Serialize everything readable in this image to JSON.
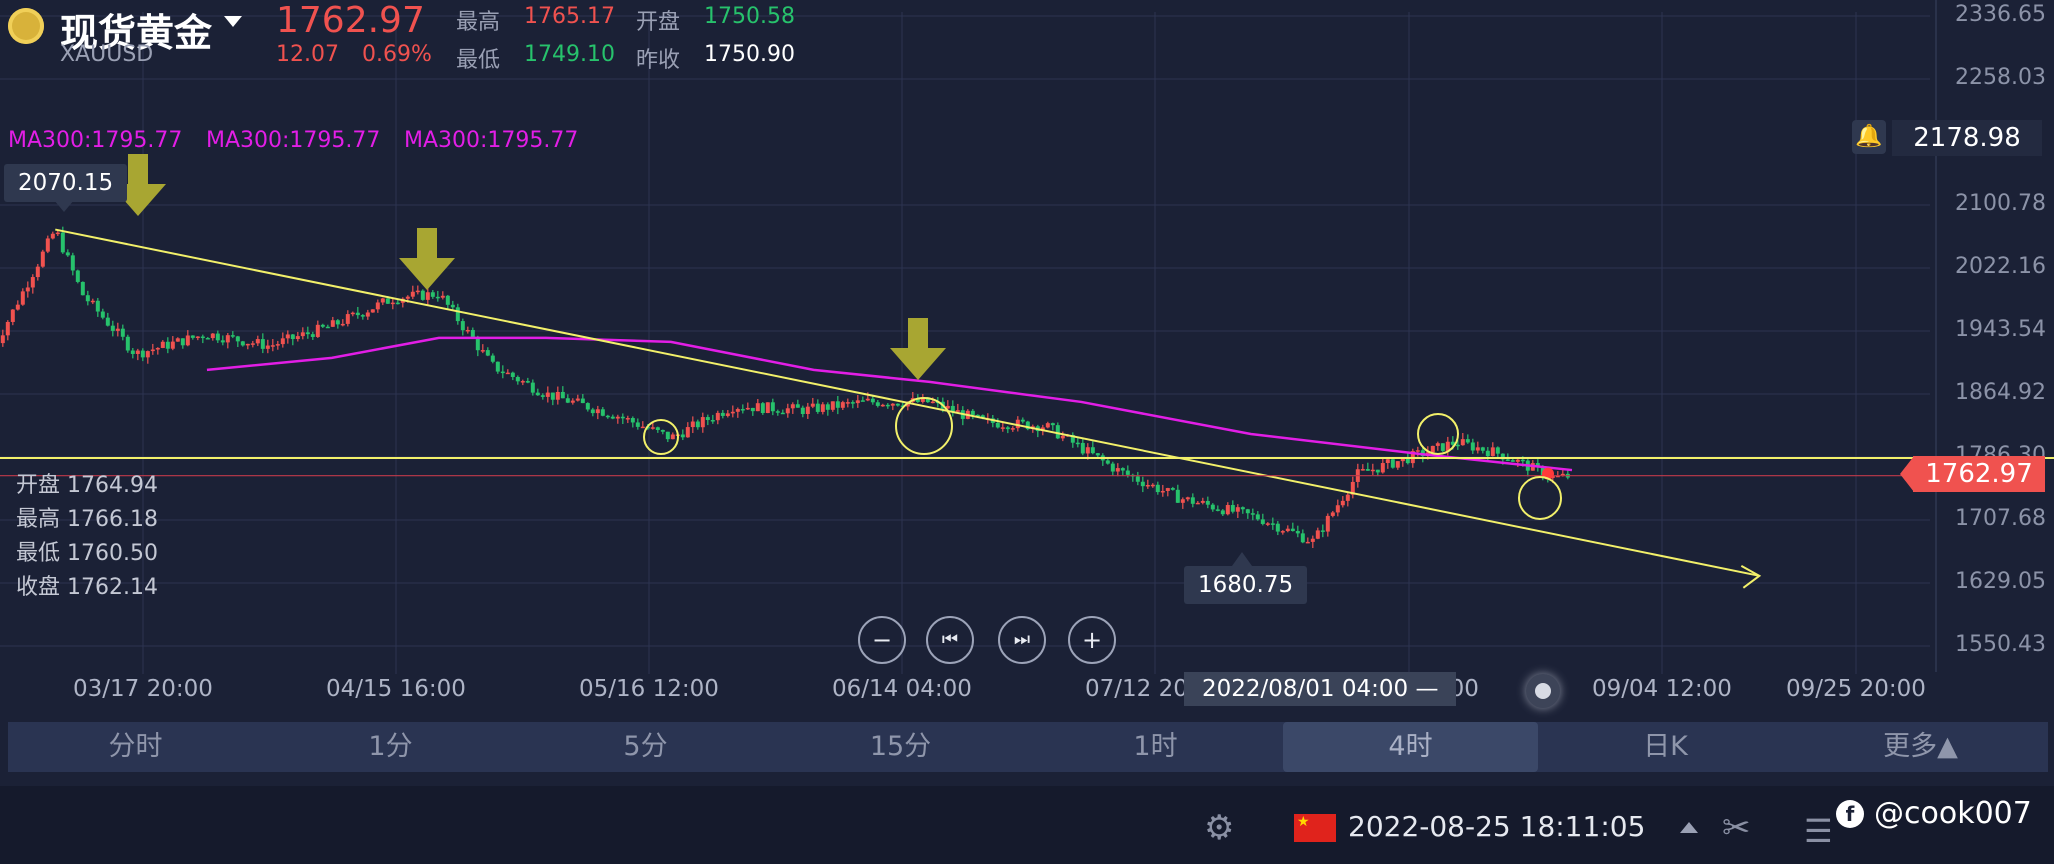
{
  "header": {
    "title": "现货黄金",
    "symbol": "XAUUSD",
    "last_price": "1762.97",
    "change": "12.07",
    "change_pct": "0.69%",
    "high_label": "最高",
    "high": "1765.17",
    "open_label": "开盘",
    "open": "1750.58",
    "low_label": "最低",
    "low": "1749.10",
    "prev_close_label": "昨收",
    "prev_close": "1750.90"
  },
  "ma_labels": [
    "MA300:1795.77",
    "MA300:1795.77",
    "MA300:1795.77"
  ],
  "alert_price": "2178.98",
  "current_price_tag": "1762.97",
  "high_marker": "2070.15",
  "low_marker": "1680.75",
  "crosshair_time": "2022/08/01 04:00 —",
  "ohlc_panel": {
    "open_label": "开盘",
    "open": "1764.94",
    "high_label": "最高",
    "high": "1766.18",
    "low_label": "最低",
    "low": "1760.50",
    "close_label": "收盘",
    "close": "1762.14"
  },
  "timeframes": [
    "分时",
    "1分",
    "5分",
    "15分",
    "1时",
    "4时",
    "日K",
    "更多▲"
  ],
  "active_timeframe": "4时",
  "status_bar": {
    "datetime": "2022-08-25 18:11:05",
    "watermark": "@cook007"
  },
  "colors": {
    "background": "#1b2136",
    "up": "#f0524f",
    "down": "#27c26c",
    "ma300": "#e21ee6",
    "trendline": "#f2f06a",
    "marker_arrow": "#a8a632"
  },
  "chart_data": {
    "type": "line",
    "title": "现货黄金 XAUUSD 4时",
    "y_ticks": [
      "2336.65",
      "2258.03",
      "2100.78",
      "2022.16",
      "1943.54",
      "1864.92",
      "1786.30",
      "1707.68",
      "1629.05",
      "1550.43"
    ],
    "ylim": [
      1550.43,
      2336.65
    ],
    "x_ticks": [
      "03/17 20:00",
      "04/15 16:00",
      "05/16 12:00",
      "06/14 04:00",
      "07/12 20:00",
      "08/11 20:00",
      "09/04 12:00",
      "09/25 20:00"
    ],
    "series": [
      {
        "name": "price",
        "x": [
          "03/01",
          "03/08",
          "03/11",
          "03/17",
          "03/25",
          "04/01",
          "04/08",
          "04/15",
          "04/20",
          "04/26",
          "05/02",
          "05/10",
          "05/16",
          "05/23",
          "05/31",
          "06/07",
          "06/14",
          "06/20",
          "06/27",
          "07/05",
          "07/12",
          "07/21",
          "07/27",
          "08/01",
          "08/08",
          "08/12",
          "08/17",
          "08/23",
          "08/25"
        ],
        "y": [
          1920,
          2070.15,
          1990,
          1915,
          1940,
          1925,
          1950,
          1985,
          1990,
          1900,
          1865,
          1838,
          1810,
          1850,
          1845,
          1855,
          1855,
          1830,
          1825,
          1770,
          1735,
          1710,
          1680.75,
          1765,
          1790,
          1805,
          1790,
          1760,
          1762.97
        ]
      },
      {
        "name": "MA300",
        "x": [
          "03/25",
          "04/08",
          "04/20",
          "05/02",
          "05/16",
          "06/01",
          "06/14",
          "07/01",
          "07/20",
          "08/08",
          "08/25"
        ],
        "y": [
          1895,
          1910,
          1935,
          1935,
          1930,
          1895,
          1880,
          1855,
          1815,
          1790,
          1770
        ]
      }
    ],
    "annotations": {
      "descending_trendline": {
        "from": [
          "03/08",
          2070.15
        ],
        "to": [
          "09/15",
          1638
        ]
      },
      "horizontal_support": 1785,
      "current_price_line": 1762.97
    }
  }
}
